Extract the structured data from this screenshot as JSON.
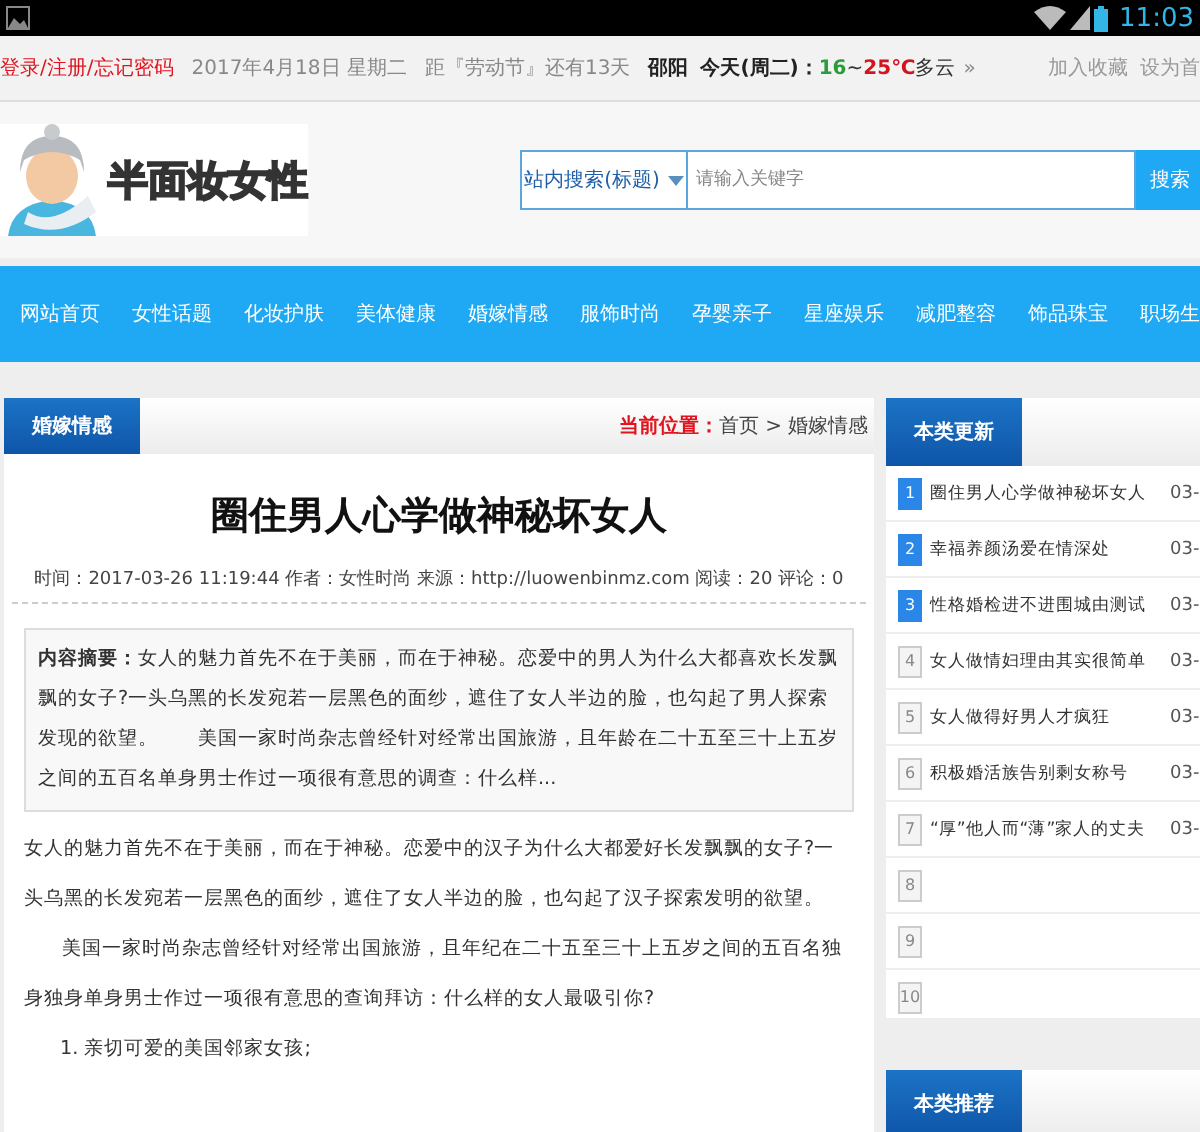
{
  "status_bar": {
    "time": "11:03"
  },
  "top_bar": {
    "links": [
      "登录",
      "注册",
      "忘记密码"
    ],
    "separator": "/",
    "date": "2017年4月18日 星期二",
    "countdown": "距『劳动节』还有13天",
    "city": "邵阳",
    "weather_label": "今天(周二)：",
    "temp_low": "16",
    "temp_sep": "~",
    "temp_high": "25℃",
    "weather": "多云",
    "more": "»",
    "right_links": [
      "加入收藏",
      "设为首"
    ]
  },
  "header": {
    "logo_text": "半面妆女性",
    "search_scope": "站内搜索(标题)",
    "search_placeholder": "请输入关键字",
    "search_button": "搜索"
  },
  "nav": [
    {
      "label": "网站首页"
    },
    {
      "label": "女性话题"
    },
    {
      "label": "化妆护肤"
    },
    {
      "label": "美体健康"
    },
    {
      "label": "婚嫁情感"
    },
    {
      "label": "服饰时尚"
    },
    {
      "label": "孕婴亲子"
    },
    {
      "label": "星座娱乐"
    },
    {
      "label": "减肥整容"
    },
    {
      "label": "饰品珠宝"
    },
    {
      "label": "职场生"
    }
  ],
  "article": {
    "category_tab": "婚嫁情感",
    "breadcrumb_label": "当前位置：",
    "breadcrumb": [
      "首页",
      "婚嫁情感"
    ],
    "breadcrumb_sep": ">",
    "title": "圈住男人心学做神秘坏女人",
    "meta": "时间：2017-03-26 11:19:44  作者：女性时尚  来源：http://luowenbinmz.com  阅读：20  评论：0",
    "summary": "**内容摘要：**女人的魅力首先不在于美丽，而在于神秘。恋爱中的男人为什么大都喜欢长发飘飘的女子?一头乌黑的长发宛若一层黑色的面纱，遮住了女人半边的脸，也勾起了男人探索发现的欲望。　　美国一家时尚杂志曾经针对经常出国旅游，且年龄在二十五至三十上五岁之间的五百名单身男士作过一项很有意思的调查：什么样...",
    "paragraphs": [
      {
        "kind": "plain",
        "text": "女人的魅力首先不在于美丽，而在于神秘。恋爱中的汉子为什么大都爱好长发飘飘的女子?一头乌黑的长发宛若一层黑色的面纱，遮住了女人半边的脸，也勾起了汉子探索发明的欲望。"
      },
      {
        "kind": "indent",
        "text": "美国一家时尚杂志曾经针对经常出国旅游，且年纪在二十五至三十上五岁之间的五百名独身独身单身男士作过一项很有意思的查询拜访：什么样的女人最吸引你?"
      },
      {
        "kind": "list",
        "text": "1. 亲切可爱的美国邻家女孩;"
      }
    ]
  },
  "sidebar": {
    "updates_title": "本类更新",
    "items": [
      {
        "number": "1",
        "title": "圈住男人心学做神秘坏女人",
        "date": "03-",
        "highlighted": true
      },
      {
        "number": "2",
        "title": "幸福养颜汤爱在情深处",
        "date": "03-",
        "highlighted": true
      },
      {
        "number": "3",
        "title": "性格婚检进不进围城由测试",
        "date": "03-",
        "highlighted": true
      },
      {
        "number": "4",
        "title": "女人做情妇理由其实很简单",
        "date": "03-",
        "highlighted": false
      },
      {
        "number": "5",
        "title": "女人做得好男人才疯狂",
        "date": "03-",
        "highlighted": false
      },
      {
        "number": "6",
        "title": "积极婚活族告别剩女称号",
        "date": "03-",
        "highlighted": false
      },
      {
        "number": "7",
        "title": "“厚”他人而“薄”家人的丈夫",
        "date": "03-",
        "highlighted": false
      },
      {
        "number": "8",
        "highlighted": false
      },
      {
        "number": "9",
        "highlighted": false
      },
      {
        "number": "10",
        "highlighted": false
      }
    ],
    "recommend_title": "本类推荐"
  }
}
